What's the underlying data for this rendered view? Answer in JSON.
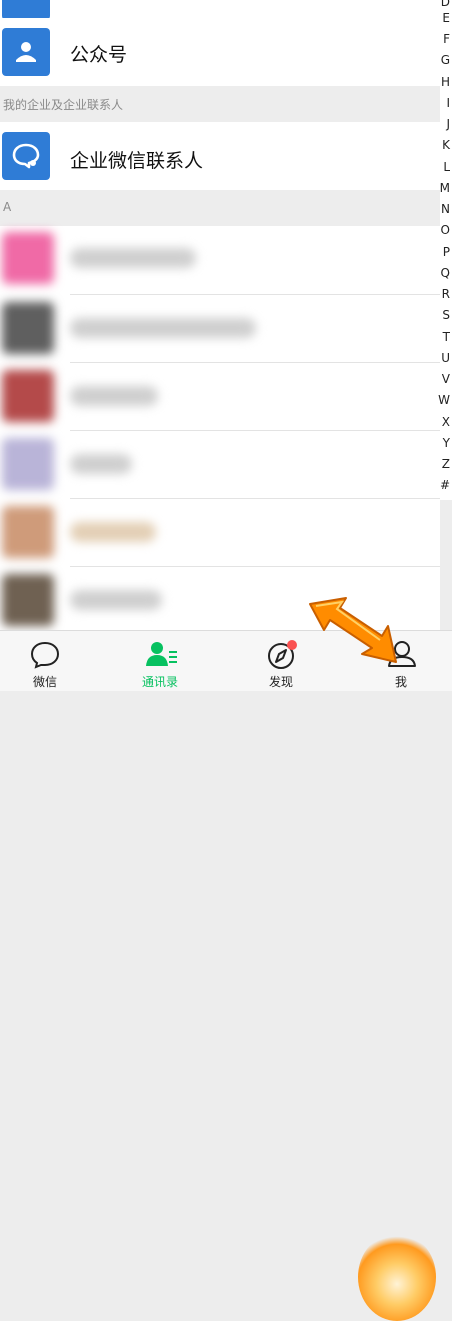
{
  "special_rows": [
    {
      "label": "公众号"
    },
    {
      "label": "企业微信联系人"
    }
  ],
  "sections": {
    "enterprise": "我的企业及企业联系人",
    "a": "A"
  },
  "index_letters": [
    "D",
    "E",
    "F",
    "G",
    "H",
    "I",
    "J",
    "K",
    "L",
    "M",
    "N",
    "O",
    "P",
    "Q",
    "R",
    "S",
    "T",
    "U",
    "V",
    "W",
    "X",
    "Y",
    "Z",
    "#"
  ],
  "tabs": [
    {
      "label": "微信",
      "icon": "chat-bubble-icon",
      "active": false
    },
    {
      "label": "通讯录",
      "icon": "contacts-icon",
      "active": true
    },
    {
      "label": "发现",
      "icon": "compass-icon",
      "active": false,
      "badge": true
    },
    {
      "label": "我",
      "icon": "person-icon",
      "active": false
    }
  ],
  "colors": {
    "accent": "#07c160",
    "row_icon_blue": "#2f7cd6",
    "badge_red": "#fa5151",
    "highlight": "#ff9a1f"
  }
}
